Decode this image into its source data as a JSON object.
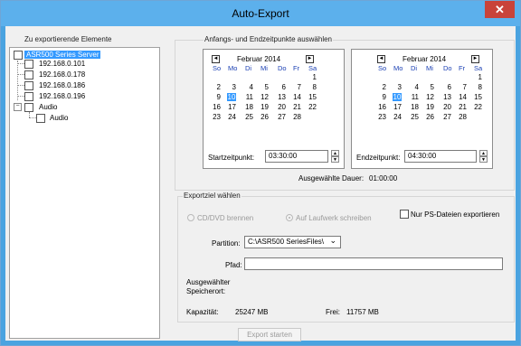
{
  "window": {
    "title": "Auto-Export",
    "close_glyph": "✕"
  },
  "left": {
    "group_label": "Zu exportierende Elemente",
    "root": "ASR500 Series Server",
    "ips": [
      "192.168.0.101",
      "192.168.0.178",
      "192.168.0.186",
      "192.168.0.196"
    ],
    "audio_parent": "Audio",
    "audio_child": "Audio",
    "expander_glyph": "−"
  },
  "range": {
    "group_label": "Anfangs- und Endzeitpunkte auswählen",
    "cal_title": "Februar 2014",
    "weekdays": [
      "So",
      "Mo",
      "Di",
      "Mi",
      "Do",
      "Fr",
      "Sa"
    ],
    "prev_glyph": "◄",
    "next_glyph": "►",
    "start_label": "Startzeitpunkt:",
    "start_value": "03:30:00",
    "end_label": "Endzeitpunkt:",
    "end_value": "04:30:00",
    "duration_label": "Ausgewählte Dauer:",
    "duration_value": "01:00:00",
    "today": "10",
    "up_glyph": "▲",
    "down_glyph": "▼"
  },
  "export": {
    "group_label": "Exportziel wählen",
    "cd_label": "CD/DVD brennen",
    "drive_label": "Auf Laufwerk schreiben",
    "ps_label": "Nur PS-Dateien exportieren",
    "partition_label": "Partition:",
    "partition_value": "C:\\ASR500 SeriesFiles\\",
    "chevron": "⌄",
    "path_label": "Pfad:",
    "path_value": "",
    "storage_label_1": "Ausgewählter",
    "storage_label_2": "Speicherort:",
    "capacity_label": "Kapazität:",
    "capacity_value": "25247 MB",
    "free_label": "Frei:",
    "free_value": "11757 MB"
  },
  "start_button": "Export starten"
}
